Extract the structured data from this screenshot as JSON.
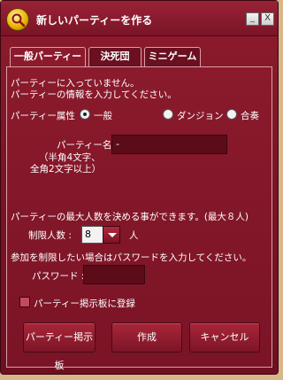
{
  "window": {
    "title": "新しいパーティーを作る",
    "minimize_label": "_",
    "close_label": "X"
  },
  "tabs": [
    {
      "label": "一般パーティー",
      "active": true
    },
    {
      "label": "決死団",
      "active": false
    },
    {
      "label": "ミニゲーム",
      "active": false
    }
  ],
  "info": {
    "line1": "パーティーに入っていません。",
    "line2": "パーティーの情報を入力してください。"
  },
  "attribute": {
    "label": "パーティー属性",
    "options": [
      {
        "label": "一般",
        "selected": true
      },
      {
        "label": "ダンジョン",
        "selected": false
      },
      {
        "label": "合奏",
        "selected": false
      }
    ]
  },
  "party_name": {
    "label": "パーティー名",
    "hint1": "（半角4文字、",
    "hint2": "全角2文字以上）",
    "value": "-"
  },
  "limit": {
    "description": "パーティーの最大人数を決める事ができます。(最大８人)",
    "label": "制限人数 :",
    "value": "8",
    "unit": "人"
  },
  "password": {
    "description": "参加を制限したい場合はパスワードを入力してください。",
    "label": "パスワード :",
    "value": ""
  },
  "register": {
    "label": "パーティー掲示板に登録",
    "checked": false
  },
  "buttons": {
    "board": "パーティー掲示板",
    "create": "作成",
    "cancel": "キャンセル"
  }
}
